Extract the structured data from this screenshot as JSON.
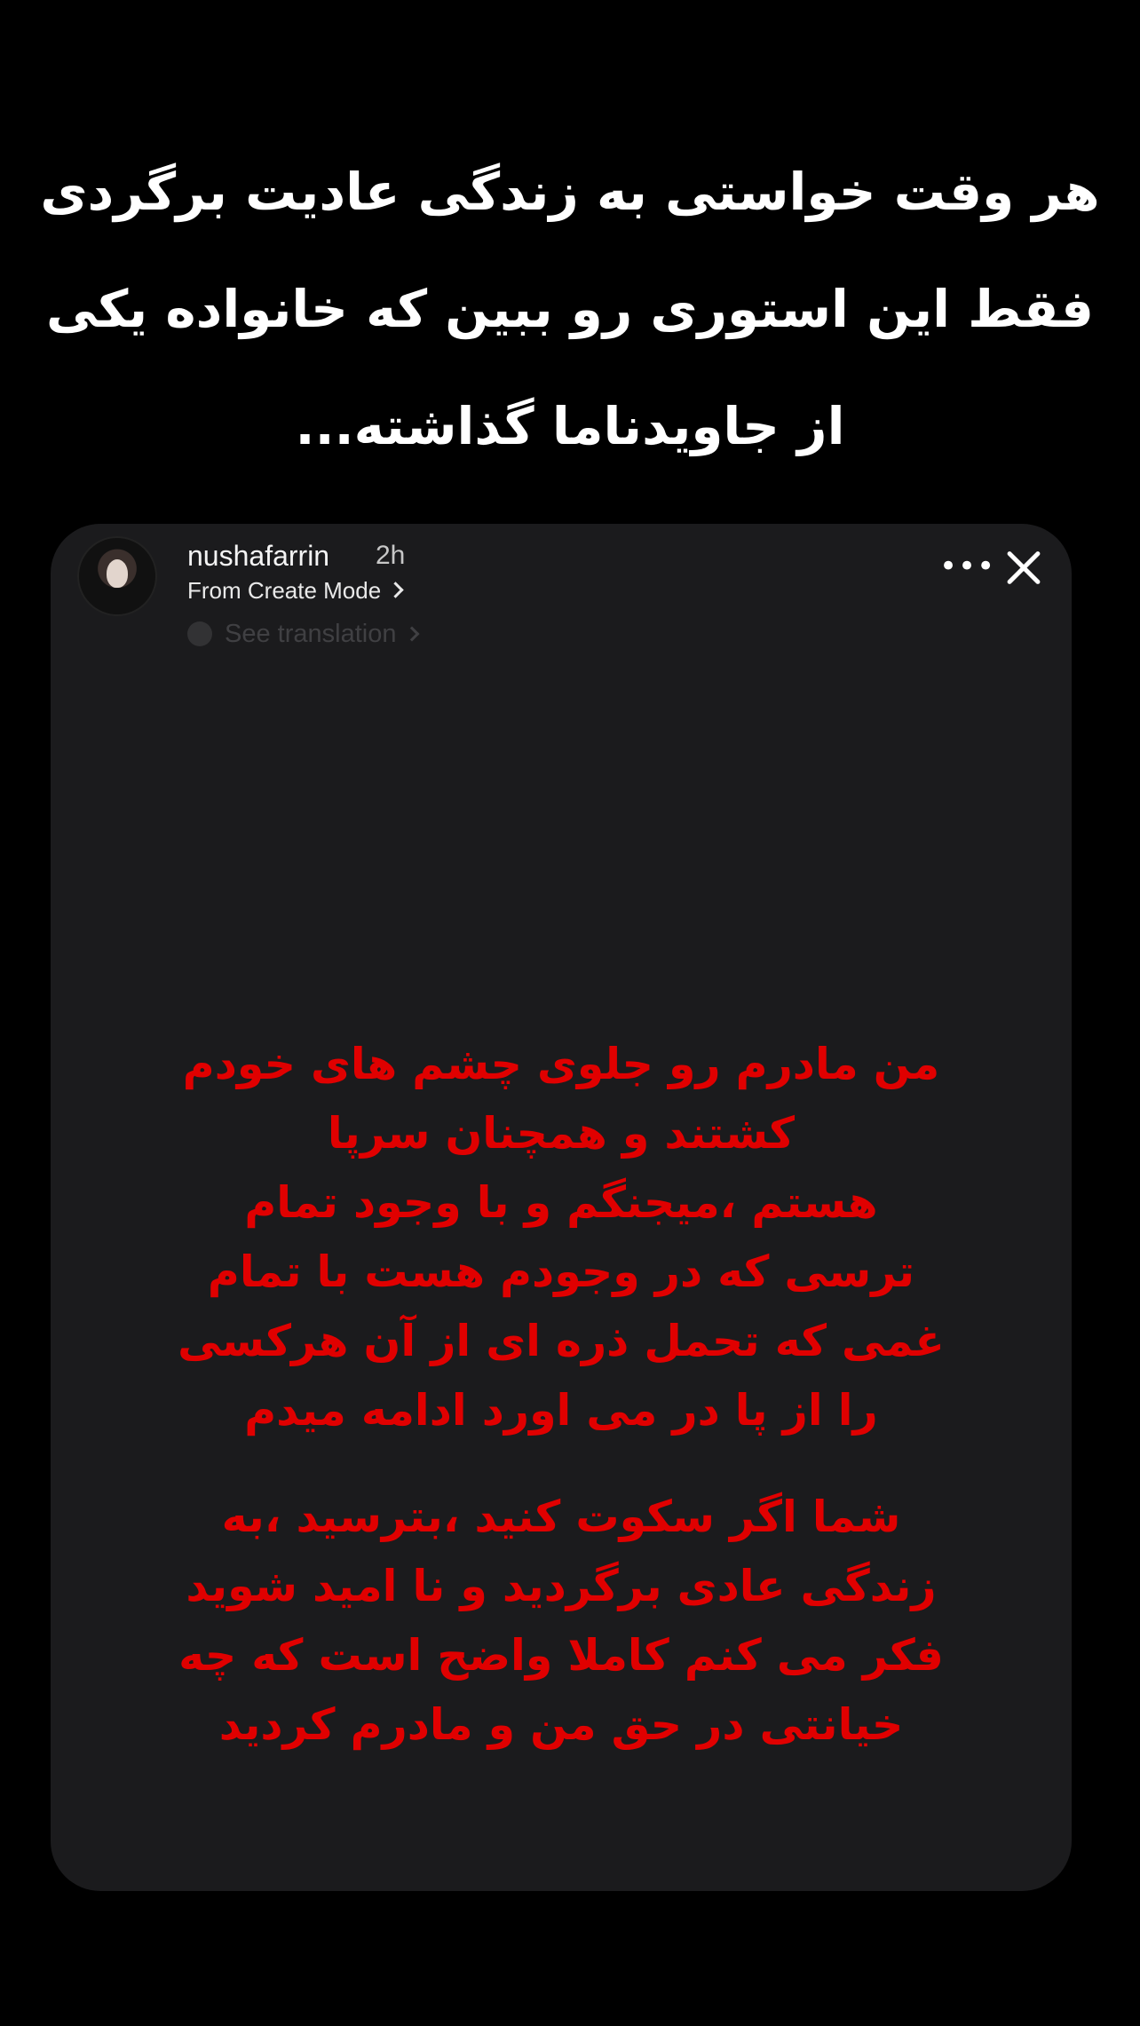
{
  "caption": {
    "lines": [
      "هر وقت خواستی به زندگی عادیت برگردی",
      "فقط این استوری رو ببین که خانواده یکی",
      "از جاویدناما گذاشته..."
    ]
  },
  "story": {
    "username": "nushafarrin",
    "time": "2h",
    "subtitle": "From Create Mode",
    "translation_label": "See translation",
    "more_icon": "more-horizontal-icon",
    "close_icon": "close-icon",
    "text_color": "#e00000",
    "paragraphs": [
      [
        "من مادرم رو جلوی چشم های خودم",
        "کشتند و همچنان سرپا",
        "هستم ،میجنگم و با وجود تمام",
        "ترسی که در وجودم هست با تمام",
        "غمی که تحمل ذره ای از آن هرکسی",
        "را از پا در می اورد ادامه میدم"
      ],
      [
        "شما اگر سکوت کنید ،بترسید ،به",
        "زندگی عادی برگردید و نا امید شوید",
        "فکر می کنم کاملا واضح است که چه",
        "خیانتی در حق من و مادرم کردید"
      ]
    ]
  }
}
